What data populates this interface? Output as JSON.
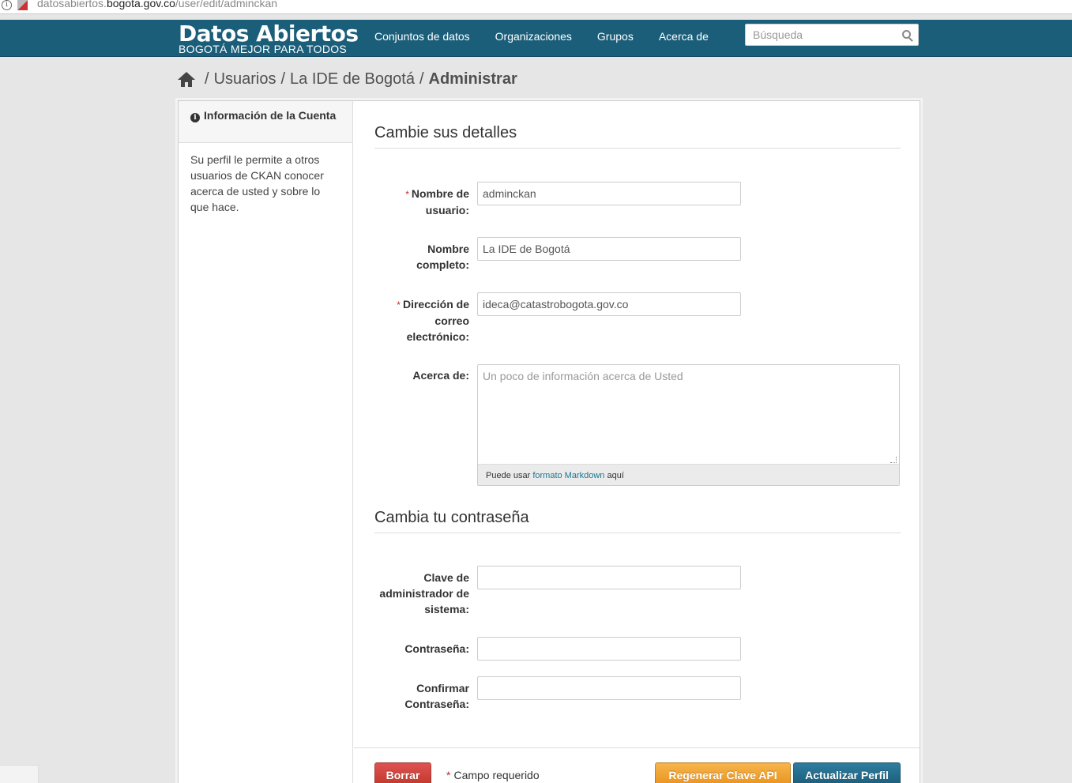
{
  "browser": {
    "url_prefix": "datosabiertos.",
    "url_domain": "bogota.gov.co",
    "url_path": "/user/edit/adminckan"
  },
  "header": {
    "logo_title": "Datos Abiertos",
    "logo_subtitle": "BOGOTÁ MEJOR PARA TODOS",
    "nav": [
      "Conjuntos de datos",
      "Organizaciones",
      "Grupos",
      "Acerca de"
    ],
    "search_placeholder": "Búsqueda"
  },
  "breadcrumb": {
    "items": [
      "Usuarios",
      "La IDE de Bogotá"
    ],
    "active": "Administrar",
    "separator": "/"
  },
  "sidebar": {
    "title": "Información de la Cuenta",
    "body": "Su perfil le permite a otros usuarios de CKAN conocer acerca de usted y sobre lo que hace."
  },
  "details": {
    "heading": "Cambie sus detalles",
    "username_label": "Nombre de usuario:",
    "username_value": "adminckan",
    "fullname_label": "Nombre completo:",
    "fullname_value": "La IDE de Bogotá",
    "email_label": "Dirección de correo electrónico:",
    "email_value": "ideca@catastrobogota.gov.co",
    "about_label": "Acerca de:",
    "about_placeholder": "Un poco de información acerca de Usted",
    "markdown_prefix": "Puede usar",
    "markdown_link": "formato Markdown",
    "markdown_suffix": "aquí"
  },
  "password": {
    "heading": "Cambia tu contraseña",
    "sysadmin_label": "Clave de administrador de sistema:",
    "password_label": "Contraseña:",
    "confirm_label": "Confirmar Contraseña:"
  },
  "actions": {
    "delete": "Borrar",
    "required_note": "Campo requerido",
    "required_marker": "*",
    "regenerate": "Regenerar Clave API",
    "update": "Actualizar Perfil"
  },
  "colors": {
    "header_bg": "#1b5e7a",
    "danger": "#c0392b",
    "warning": "#e99320",
    "primary": "#1c5d7a",
    "link": "#187794"
  }
}
